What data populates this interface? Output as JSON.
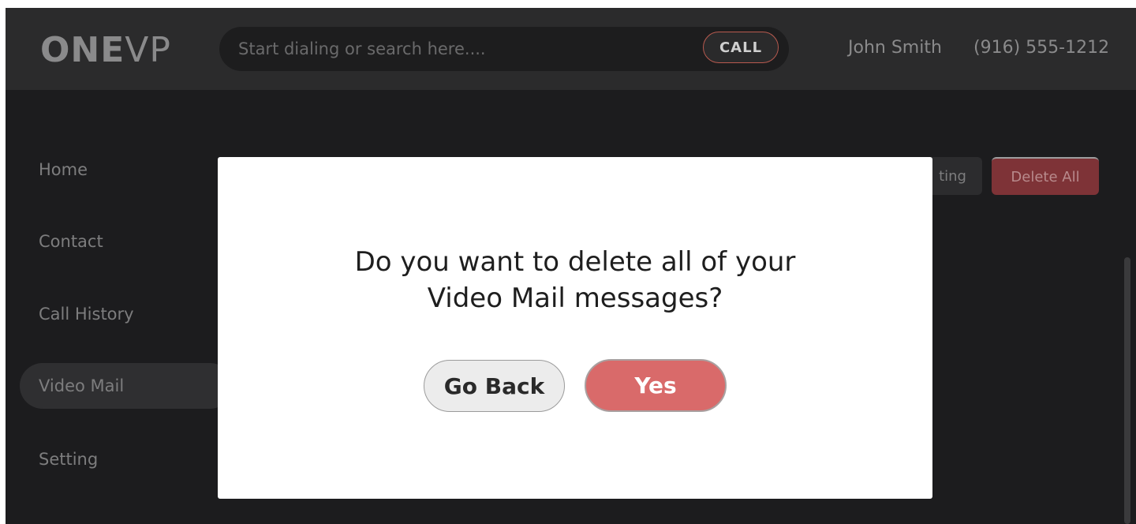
{
  "header": {
    "logo_bold": "ONE",
    "logo_light": "VP",
    "search_placeholder": "Start dialing or search here....",
    "call_label": "CALL",
    "user_name": "John Smith",
    "user_phone": "(916) 555-1212"
  },
  "sidebar": {
    "items": [
      {
        "label": "Home"
      },
      {
        "label": "Contact"
      },
      {
        "label": "Call History"
      },
      {
        "label": "Video Mail",
        "active": true
      },
      {
        "label": "Setting"
      }
    ]
  },
  "toolbar": {
    "setting_partial_label": "ting",
    "delete_all_label": "Delete All"
  },
  "dialog": {
    "message_line1": "Do you want to delete all of your",
    "message_line2": "Video Mail messages?",
    "go_back_label": "Go Back",
    "yes_label": "Yes"
  },
  "colors": {
    "accent_red": "#d96a6a",
    "background_dark": "#1c1c1e",
    "topbar": "#2b2b2c"
  }
}
